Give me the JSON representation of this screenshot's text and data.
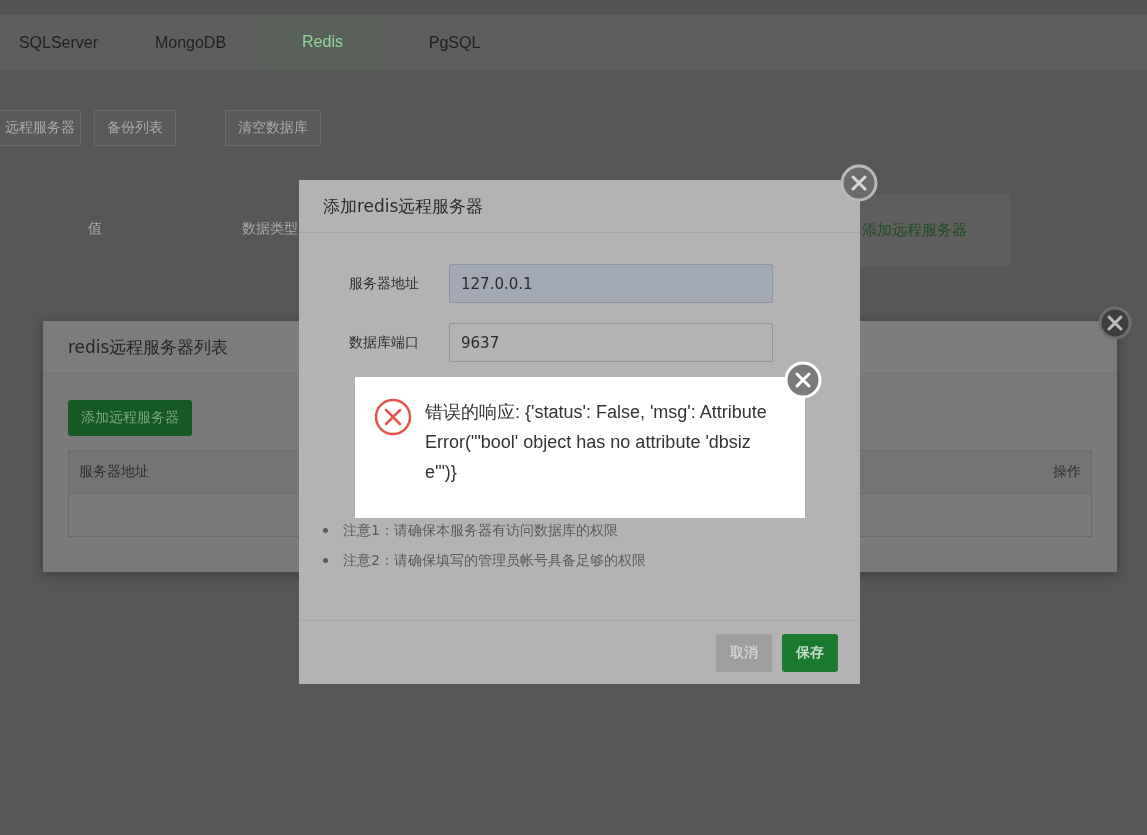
{
  "tabs": [
    {
      "label": "SQLServer",
      "selected": false
    },
    {
      "label": "MongoDB",
      "selected": false
    },
    {
      "label": "Redis",
      "selected": true
    },
    {
      "label": "PgSQL",
      "selected": false
    }
  ],
  "toolbar": [
    "远程服务器",
    "备份列表",
    "清空数据库"
  ],
  "table_columns": [
    "值",
    "数据类型"
  ],
  "side_panel": {
    "button": "添加远程服务器"
  },
  "server_list_dialog": {
    "title": "redis远程服务器列表",
    "add_button": "添加远程服务器",
    "columns": [
      "服务器地址",
      "操作"
    ]
  },
  "add_dialog": {
    "title": "添加redis远程服务器",
    "fields": [
      {
        "label": "服务器地址",
        "value": "127.0.0.1",
        "focused": true
      },
      {
        "label": "数据库端口",
        "value": "9637",
        "focused": false
      }
    ],
    "notes": [
      "注意1：请确保本服务器有访问数据库的权限",
      "注意2：请确保填写的管理员帐号具备足够的权限"
    ],
    "buttons": [
      {
        "label": "取消",
        "kind": "cancel"
      },
      {
        "label": "保存",
        "kind": "primary"
      }
    ]
  },
  "error_toast": {
    "message": "错误的响应: {'status': False, 'msg': AttributeError(\"'bool' object has no attribute 'dbsize'\")}"
  }
}
